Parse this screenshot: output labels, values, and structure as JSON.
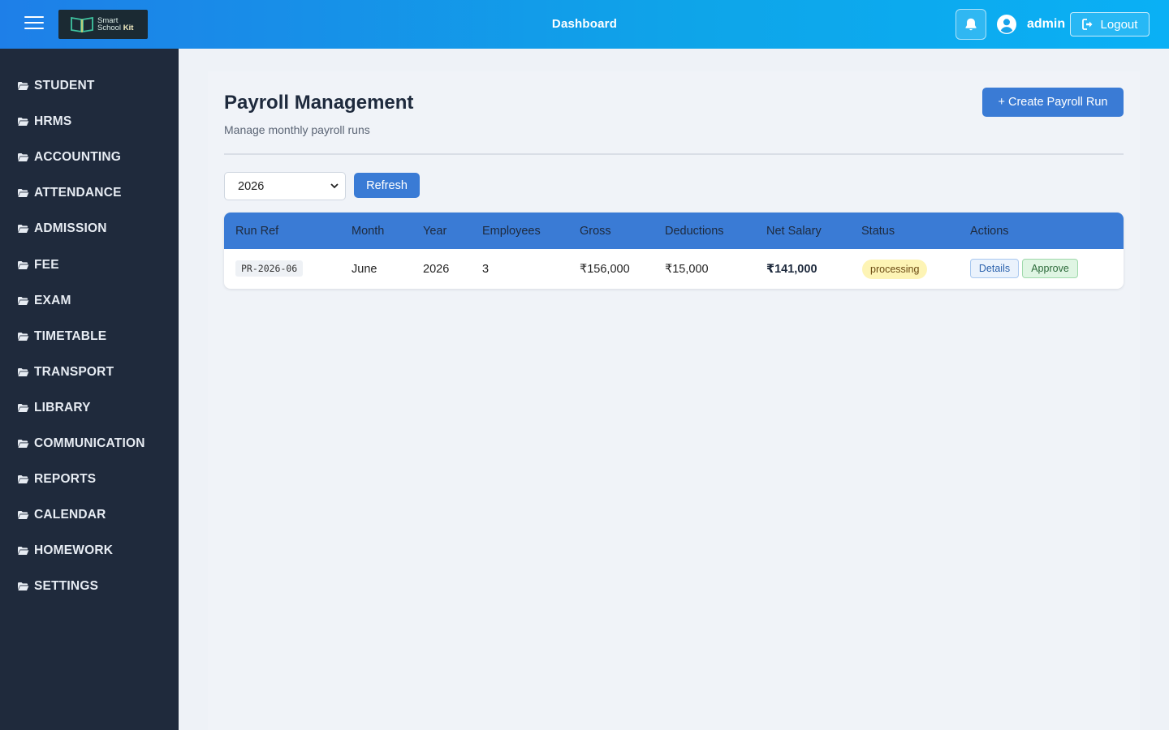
{
  "header": {
    "title": "Dashboard",
    "user_name": "admin",
    "logout_label": "Logout",
    "logo": {
      "line1": "Smart",
      "line2": "School",
      "line3": "Kit"
    }
  },
  "sidebar": {
    "items": [
      {
        "label": "STUDENT",
        "icon": "folder-open-icon"
      },
      {
        "label": "HRMS",
        "icon": "folder-open-icon"
      },
      {
        "label": "ACCOUNTING",
        "icon": "folder-open-icon"
      },
      {
        "label": "ATTENDANCE",
        "icon": "folder-open-icon"
      },
      {
        "label": "ADMISSION",
        "icon": "folder-open-icon"
      },
      {
        "label": "FEE",
        "icon": "folder-open-icon"
      },
      {
        "label": "EXAM",
        "icon": "folder-open-icon"
      },
      {
        "label": "TIMETABLE",
        "icon": "folder-open-icon"
      },
      {
        "label": "TRANSPORT",
        "icon": "folder-open-icon"
      },
      {
        "label": "LIBRARY",
        "icon": "folder-open-icon"
      },
      {
        "label": "COMMUNICATION",
        "icon": "folder-open-icon"
      },
      {
        "label": "REPORTS",
        "icon": "folder-open-icon"
      },
      {
        "label": "CALENDAR",
        "icon": "folder-open-icon"
      },
      {
        "label": "HOMEWORK",
        "icon": "folder-open-icon"
      },
      {
        "label": "SETTINGS",
        "icon": "folder-open-icon"
      }
    ]
  },
  "page": {
    "title": "Payroll Management",
    "subtitle": "Manage monthly payroll runs",
    "create_button": "+ Create Payroll Run",
    "year_filter": "2026",
    "refresh_button": "Refresh"
  },
  "table": {
    "columns": [
      "Run Ref",
      "Month",
      "Year",
      "Employees",
      "Gross",
      "Deductions",
      "Net Salary",
      "Status",
      "Actions"
    ],
    "rows": [
      {
        "run_ref": "PR-2026-06",
        "month": "June",
        "year": "2026",
        "employees": "3",
        "gross": "₹156,000",
        "deductions": "₹15,000",
        "net_salary": "₹141,000",
        "status": "processing",
        "actions": [
          "Details",
          "Approve"
        ]
      }
    ]
  },
  "colors": {
    "header_gradient_start": "#1e7fe8",
    "header_gradient_end": "#0ab0f5",
    "sidebar_bg": "#1f2a3c",
    "primary": "#3a7bd5",
    "status_processing_bg": "#fdf4b5"
  }
}
